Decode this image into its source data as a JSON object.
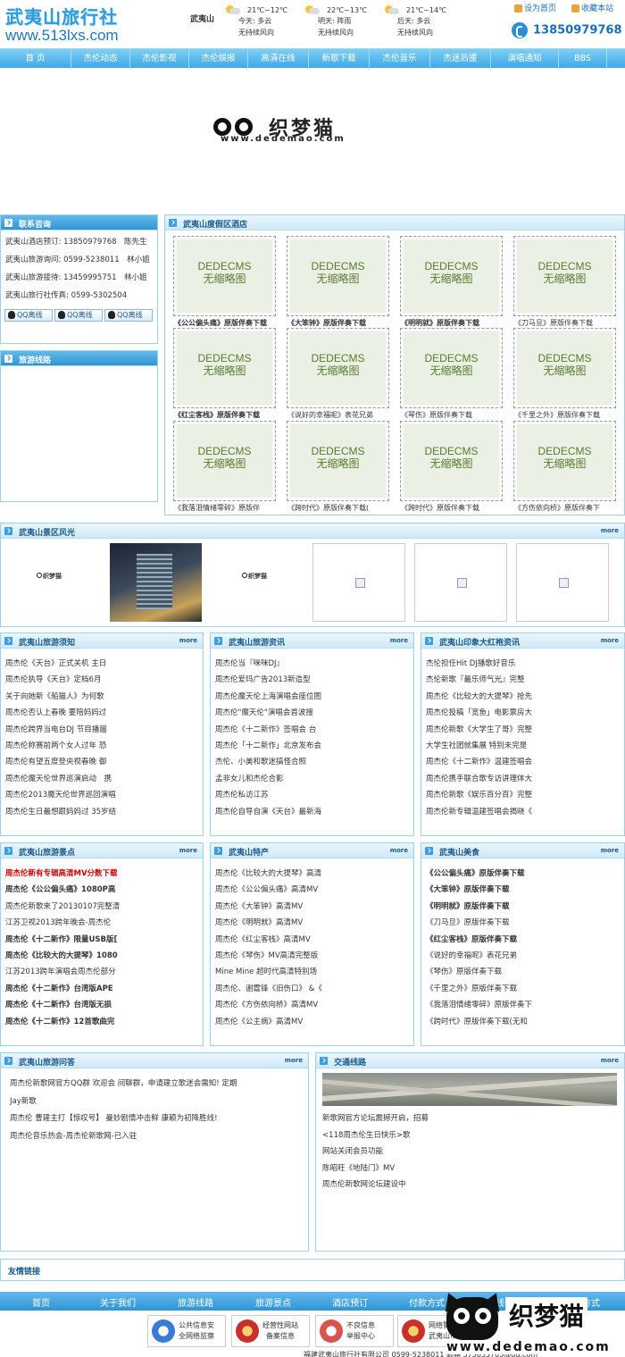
{
  "header": {
    "logo_cn": "武夷山旅行社",
    "logo_url": "www.513lxs.com",
    "city": "武夷山",
    "weather": [
      {
        "temp": "21℃~12℃",
        "day": "今天: 多云",
        "wind": "无持续风向"
      },
      {
        "temp": "22℃~13℃",
        "day": "明天: 阵雨",
        "wind": "无持续风向"
      },
      {
        "temp": "21℃~14℃",
        "day": "后天: 多云",
        "wind": "无持续风向"
      }
    ],
    "set_home": "设为首页",
    "bookmark": "收藏本站",
    "phone": "13850979768"
  },
  "nav": [
    "首 页",
    "杰伦动态",
    "杰伦影视",
    "杰伦娱报",
    "高清在线",
    "新歌下载",
    "杰伦音乐",
    "杰迷后援",
    "演唱通知",
    "BBS"
  ],
  "banner": {
    "name": "织梦猫",
    "url": "www.dedemao.com"
  },
  "contact": {
    "title": "联系咨询",
    "lines": [
      "武夷山酒店预订: 13850979768　陈先生",
      "武夷山旅游询问: 0599-5238011　林小姐",
      "武夷山旅游接待: 13459995751　林小姐",
      "武夷山旅行社传真: 0599-5302504"
    ],
    "qq_label": "QQ离线"
  },
  "routes_title": "旅游线路",
  "hotels": {
    "title": "武夷山度假区酒店",
    "placeholder": [
      "DEDECMS",
      "无缩略图"
    ],
    "items": [
      {
        "text": "《公公偏头痛》原版伴奏下载",
        "bold": true
      },
      {
        "text": "《大笨钟》原版伴奏下载",
        "bold": true
      },
      {
        "text": "《明明就》原版伴奏下载",
        "bold": true
      },
      {
        "text": "《刀马旦》原版伴奏下载",
        "bold": false
      },
      {
        "text": "《红尘客栈》原版伴奏下载",
        "bold": true
      },
      {
        "text": "《说好的幸福呢》表花兄弟",
        "bold": false
      },
      {
        "text": "《琴伤》原版伴奏下载",
        "bold": false
      },
      {
        "text": "《千里之外》原版伴奏下载",
        "bold": false
      },
      {
        "text": "《我落泪情绪零碎》原版伴",
        "bold": false
      },
      {
        "text": "《跨时代》原版伴奏下载(",
        "bold": false
      },
      {
        "text": "《跨时代》原版伴奏下载",
        "bold": false
      },
      {
        "text": "《方伤依向桥》原版伴奏下",
        "bold": false
      }
    ]
  },
  "scenery": {
    "title": "武夷山景区风光",
    "more": "more",
    "logo_text": "织梦猫"
  },
  "box_notice": {
    "title": "武夷山旅游须知",
    "more": "more",
    "items": [
      "周杰伦《天台》正式关机 主日",
      "周杰伦执导《天台》定档6月",
      "关于向她新《船猫人》为何歌",
      "周杰伦否认上春晚 要陪妈妈过",
      "周杰伦跨界当电台DJ 节目播届",
      "周杰伦称赛前两个女人过年 恐",
      "周杰伦有望五度登央视春晚 御",
      "周杰伦魔天伦世界巡演启动　携",
      "周杰伦2013魔天伦世界巡回演唱",
      "周杰伦生日最想跟妈妈过 35岁结"
    ]
  },
  "box_news": {
    "title": "武夷山旅游资讯",
    "more": "more",
    "items": [
      "周杰伦当『咪咪DJ』",
      "周杰伦爱玛广告2013新造型",
      "周杰伦魔天伦上海演唱会座位图",
      "周杰伦\"魔天伦\"演唱会首波搜",
      "周杰伦《十二新作》签唱会 台",
      "周杰伦「十二新作」北京发布会",
      "杰伦、小美和歌迷搞怪合照",
      "孟非女儿和杰伦合影",
      "周杰伦私访江苏",
      "周杰伦自导自演《天台》最新海"
    ]
  },
  "box_hongyan": {
    "title": "武夷山印象大红袍资讯",
    "more": "more",
    "items": [
      "杰伦担任Hit DJ播歌好音乐",
      "杰伦新歌『最乐师气光』完整",
      "周杰伦《比较大的大提琴》抢先",
      "周杰伦投稿「宽鱼」电影票房大",
      "周杰伦新歌《大学生了哥》完整",
      "大学生社团就集展 特别未完是",
      "周杰伦《十二新作》温建签唱会",
      "周杰伦携手联合歌专访讲理体大",
      "周杰伦新歌《娱乐百分百》完整",
      "周杰伦新专辑温建签唱会揭晓《"
    ]
  },
  "box_spots": {
    "title": "武夷山旅游景点",
    "more": "more",
    "items": [
      {
        "text": "周杰伦新有专辑高清MV分数下载",
        "style": "red"
      },
      {
        "text": "周杰伦《公公偏头痛》1080P高",
        "style": "bold"
      },
      {
        "text": "周杰伦新歌来了20130107完整清",
        "style": "normal"
      },
      {
        "text": "江苏卫视2013跨年晚会-周杰伦",
        "style": "normal"
      },
      {
        "text": "周杰伦《十二新作》限量USB版[",
        "style": "bold"
      },
      {
        "text": "周杰伦《比较大的大提琴》1080",
        "style": "bold"
      },
      {
        "text": "江苏2013跨年演唱会周杰伦部分",
        "style": "normal"
      },
      {
        "text": "周杰伦《十二新作》台湾版APE",
        "style": "bold"
      },
      {
        "text": "周杰伦《十二新作》台湾版无损",
        "style": "bold"
      },
      {
        "text": "周杰伦《十二新作》12首歌曲完",
        "style": "bold"
      }
    ]
  },
  "box_specialty": {
    "title": "武夷山特产",
    "more": "more",
    "items": [
      "周杰伦《比较大的大提琴》高清",
      "周杰伦《公公偏头痛》高清MV",
      "周杰伦《大笨钟》高清MV",
      "周杰伦《明明就》高清MV",
      "周杰伦《红尘客栈》高清MV",
      "周杰伦《琴伤》MV高清完整版",
      "Mine Mine 超时代高清特别场",
      "周杰伦、谢霆锋《旧伤口》 &《",
      "周杰伦《方伤依向桥》高清MV",
      "周杰伦《公主病》高清MV"
    ]
  },
  "box_food": {
    "title": "武夷山美食",
    "more": "more",
    "items": [
      {
        "text": "《公公偏头痛》原版伴奏下载",
        "bold": true
      },
      {
        "text": "《大笨钟》原版伴奏下载",
        "bold": true
      },
      {
        "text": "《明明就》原版伴奏下载",
        "bold": true
      },
      {
        "text": "《刀马旦》原版伴奏下载",
        "bold": false
      },
      {
        "text": "《红尘客栈》原版伴奏下载",
        "bold": true
      },
      {
        "text": "《说好的幸福呢》表花兄弟",
        "bold": false
      },
      {
        "text": "《琴伤》原版伴奏下载",
        "bold": false
      },
      {
        "text": "《千里之外》原版伴奏下载",
        "bold": false
      },
      {
        "text": "《我落泪情绪零碎》原版伴奏下",
        "bold": false
      },
      {
        "text": "《跨时代》原版伴奏下载(无和",
        "bold": false
      }
    ]
  },
  "box_qa": {
    "title": "武夷山旅游问答",
    "more": "more",
    "items": [
      "周杰伦新歌网官方QQ群 欢迎会 间聊群，申请建立歌迷会需知! 定期",
      "Jay新歌",
      "周杰伦 曹建主打【惊叹号】 曼妙剧情冲击鲜 康颖为初降胜线!",
      "周杰伦音乐热会-周杰伦新歌网-已入驻"
    ]
  },
  "box_traffic": {
    "title": "交通线路",
    "more": "more",
    "items": [
      "新歌网官方论坛震撼开启，招募",
      "<118周杰伦生日快乐>歌",
      "网站关闭会员功能",
      "陈昭旺《地陆门》MV",
      "周杰伦新歌网论坛建设中"
    ]
  },
  "links_title": "友情链接",
  "footer": {
    "nav": [
      "首页",
      "关于我们",
      "旅游线路",
      "旅游景点",
      "酒店预订",
      "付款方式",
      "在线留言",
      "联系方式"
    ],
    "badges": [
      [
        "公共信息安",
        "全网络监察"
      ],
      [
        "经营性网站",
        "备案信息"
      ],
      [
        "不良信息",
        "举报中心"
      ],
      [
        "网络警察",
        "武夷山市"
      ]
    ],
    "watermark_name": "织梦猫",
    "watermark_url": "www.dedemao.com",
    "bottom_line": "福建武夷山旅行社有限公司 0599-5238011 邮箱 573633703@qq.com"
  },
  "colors": {
    "accent": "#2f95d6",
    "nav_top": "#7fcef4",
    "border": "#9ad1ef",
    "title_text": "#1c5a8a",
    "red": "#cc0000"
  }
}
